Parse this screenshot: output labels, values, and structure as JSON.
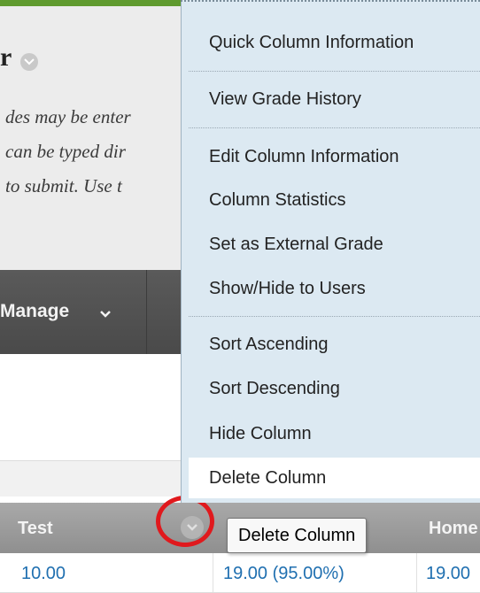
{
  "panel": {
    "title_fragment": "r",
    "instructions": [
      "des may be enter",
      "can be typed dir",
      " to submit. Use t"
    ]
  },
  "action_bar": {
    "manage_label": "Manage"
  },
  "grid": {
    "headers": [
      "Test",
      "Home"
    ],
    "row": [
      "10.00",
      "19.00 (95.00%)",
      "19.00"
    ]
  },
  "context_menu": {
    "items": [
      "Quick Column Information",
      "View Grade History",
      "Edit Column Information",
      "Column Statistics",
      "Set as External Grade",
      "Show/Hide to Users",
      "Sort Ascending",
      "Sort Descending",
      "Hide Column",
      "Delete Column"
    ],
    "active_item": "Delete Column"
  },
  "tooltip": {
    "text": "Delete Column"
  },
  "colors": {
    "accent_green": "#5f9a2e",
    "menu_background": "#dce9f2",
    "link_blue": "#1f6fb0",
    "highlight_red": "#e0191d"
  }
}
